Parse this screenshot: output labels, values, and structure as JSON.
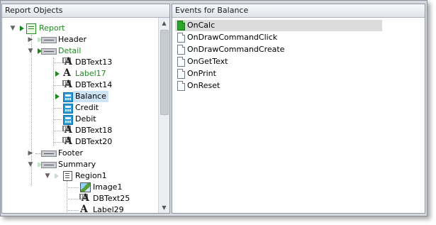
{
  "left_panel": {
    "title": "Report Objects",
    "tree": [
      {
        "label": "Report",
        "level": 0,
        "icon": "report-icon",
        "expanded": true,
        "has_event": true,
        "green": true
      },
      {
        "label": "Header",
        "level": 1,
        "icon": "band-icon",
        "expanded": false,
        "has_event": false
      },
      {
        "label": "Detail",
        "level": 1,
        "icon": "band-icon",
        "expanded": true,
        "has_event": true,
        "green": true
      },
      {
        "label": "DBText13",
        "level": 2,
        "icon": "dbtext-icon"
      },
      {
        "label": "Label17",
        "level": 2,
        "icon": "label-icon",
        "has_event": true,
        "green": true
      },
      {
        "label": "DBText14",
        "level": 2,
        "icon": "dbtext-icon"
      },
      {
        "label": "Balance",
        "level": 2,
        "icon": "dbcalc-icon",
        "has_event": true,
        "selected": true
      },
      {
        "label": "Credit",
        "level": 2,
        "icon": "dbcalc-icon"
      },
      {
        "label": "Debit",
        "level": 2,
        "icon": "dbcalc-icon"
      },
      {
        "label": "DBText18",
        "level": 2,
        "icon": "dbtext-icon"
      },
      {
        "label": "DBText20",
        "level": 2,
        "icon": "dbtext-icon"
      },
      {
        "label": "Footer",
        "level": 1,
        "icon": "band-icon",
        "expanded": false
      },
      {
        "label": "Summary",
        "level": 1,
        "icon": "band-icon",
        "expanded": true
      },
      {
        "label": "Region1",
        "level": 2,
        "icon": "region-icon",
        "expanded": true
      },
      {
        "label": "Image1",
        "level": 3,
        "icon": "image-icon"
      },
      {
        "label": "DBText25",
        "level": 3,
        "icon": "dbtext-icon"
      },
      {
        "label": "Label29",
        "level": 3,
        "icon": "label-icon"
      }
    ]
  },
  "right_panel": {
    "title": "Events for Balance",
    "events": [
      {
        "label": "OnCalc",
        "active": true
      },
      {
        "label": "OnDrawCommandClick"
      },
      {
        "label": "OnDrawCommandCreate"
      },
      {
        "label": "OnGetText"
      },
      {
        "label": "OnPrint"
      },
      {
        "label": "OnReset"
      }
    ]
  },
  "colors": {
    "accent_green": "#1c8a1c",
    "selection": "#cfe3f7",
    "active_event": "#dcdcdc"
  }
}
